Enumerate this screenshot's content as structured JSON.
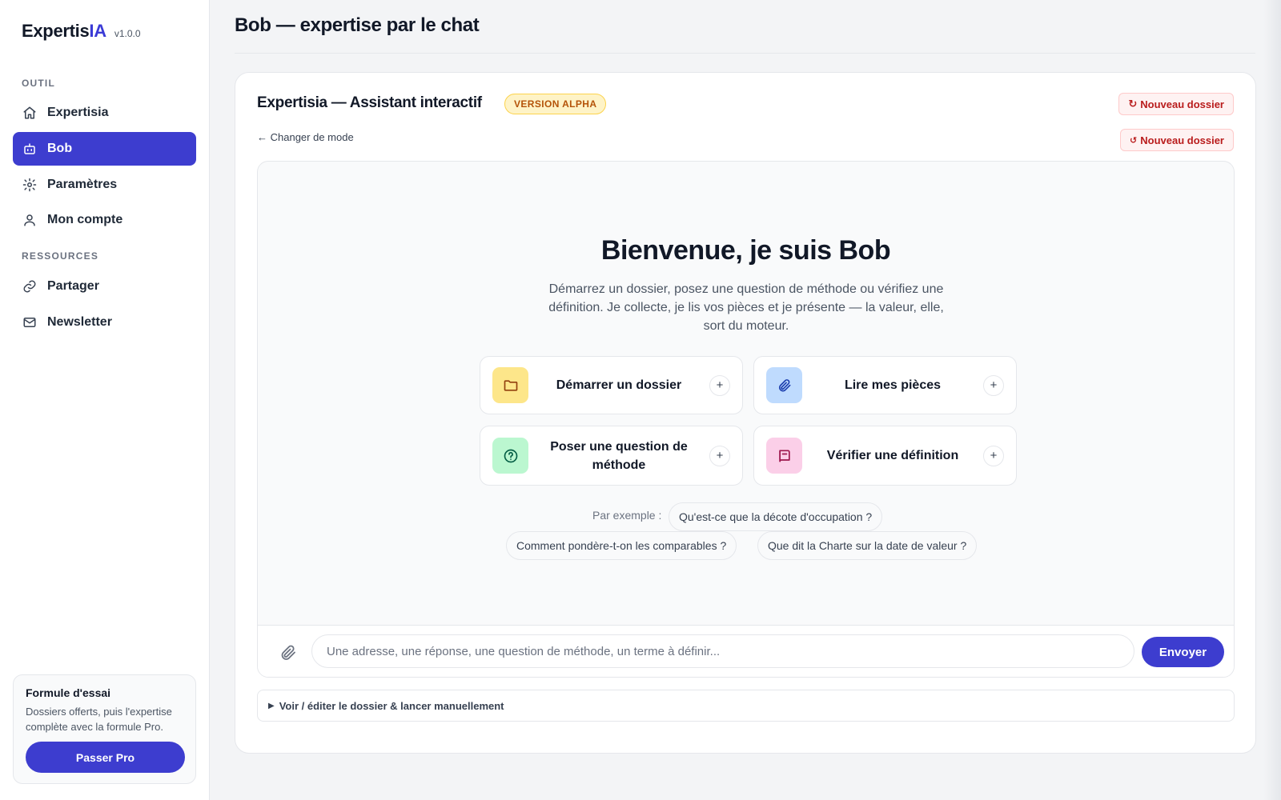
{
  "sidebar": {
    "brand": {
      "name_main": "Expertis",
      "name_accent": "IA",
      "version": "v1.0.0"
    },
    "sections": [
      {
        "label": "OUTIL",
        "items": [
          {
            "label": "Expertisia",
            "icon": "home-icon"
          },
          {
            "label": "Bob",
            "icon": "bot-icon",
            "active": true
          },
          {
            "label": "Paramètres",
            "icon": "gear-icon"
          },
          {
            "label": "Mon compte",
            "icon": "user-icon"
          }
        ]
      },
      {
        "label": "RESSOURCES",
        "items": [
          {
            "label": "Partager",
            "icon": "link-icon"
          },
          {
            "label": "Newsletter",
            "icon": "mail-icon"
          }
        ]
      }
    ],
    "trial": {
      "title": "Formule d'essai",
      "text": "Dossiers offerts, puis l'expertise complète avec la formule Pro.",
      "button": "Passer Pro"
    }
  },
  "header": {
    "title": "Bob — expertise par le chat"
  },
  "panel": {
    "title": "Expertisia — Assistant interactif",
    "badge": "VERSION ALPHA",
    "reset_buttons": [
      "Nouveau dossier",
      "Nouveau dossier"
    ],
    "change_mode": "← Changer de mode",
    "welcome": {
      "title": "Bienvenue, je suis Bob",
      "subtitle": "Démarrez un dossier, posez une question de méthode ou vérifiez une définition. Je collecte, je lis vos pièces et je présente — la valeur, elle, sort du moteur."
    },
    "actions": [
      {
        "label": "Démarrer un dossier",
        "icon": "folder-icon",
        "color": "#fde68a"
      },
      {
        "label": "Lire mes pièces",
        "icon": "paperclip-icon",
        "color": "#bfdbfe"
      },
      {
        "label": "Poser une question de méthode",
        "icon": "question-icon",
        "color": "#bbf7d0"
      },
      {
        "label": "Vérifier une définition",
        "icon": "book-icon",
        "color": "#fbcfe8"
      }
    ],
    "examples": {
      "label": "Par exemple :",
      "chips": [
        "Qu'est-ce que la décote d'occupation ?",
        "Comment pondère-t-on les comparables ?",
        "Que dit la Charte sur la date de valeur ?"
      ]
    },
    "composer": {
      "placeholder": "Une adresse, une réponse, une question de méthode, un terme à définir...",
      "value": "",
      "send": "Envoyer"
    },
    "details": {
      "label": "Voir / éditer le dossier & lancer manuellement"
    }
  },
  "colors": {
    "accent": "#3d3dcf",
    "badge_bg": "#fef3c7",
    "danger": "#b91c1c"
  }
}
